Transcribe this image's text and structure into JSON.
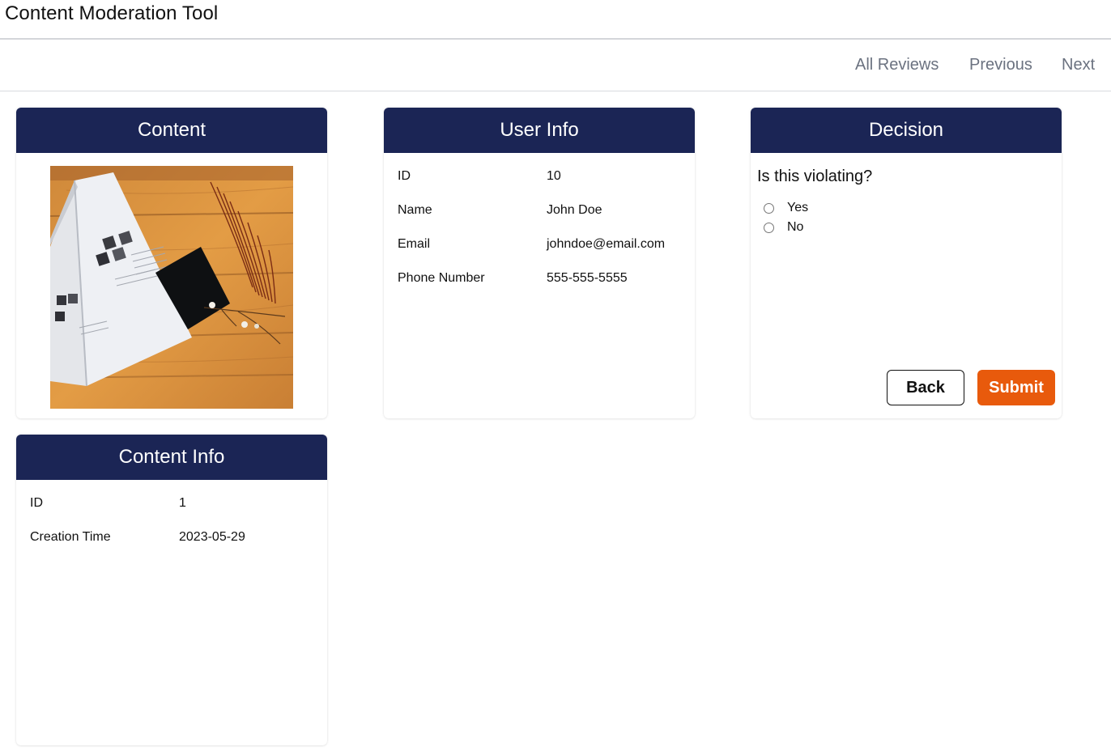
{
  "app": {
    "title": "Content Moderation Tool"
  },
  "nav": {
    "all_reviews": "All Reviews",
    "previous": "Previous",
    "next": "Next"
  },
  "content": {
    "heading": "Content"
  },
  "user_info": {
    "heading": "User Info",
    "rows": [
      {
        "key": "ID",
        "value": "10"
      },
      {
        "key": "Name",
        "value": "John Doe"
      },
      {
        "key": "Email",
        "value": "johndoe@email.com"
      },
      {
        "key": "Phone Number",
        "value": "555-555-5555"
      }
    ]
  },
  "decision": {
    "heading": "Decision",
    "question": "Is this violating?",
    "options": [
      "Yes",
      "No"
    ],
    "back_label": "Back",
    "submit_label": "Submit"
  },
  "content_info": {
    "heading": "Content Info",
    "rows": [
      {
        "key": "ID",
        "value": "1"
      },
      {
        "key": "Creation Time",
        "value": "2023-05-29"
      }
    ]
  },
  "colors": {
    "header_navy": "#1b2555",
    "submit_orange": "#e85a0c",
    "nav_link_gray": "#6b7280"
  }
}
